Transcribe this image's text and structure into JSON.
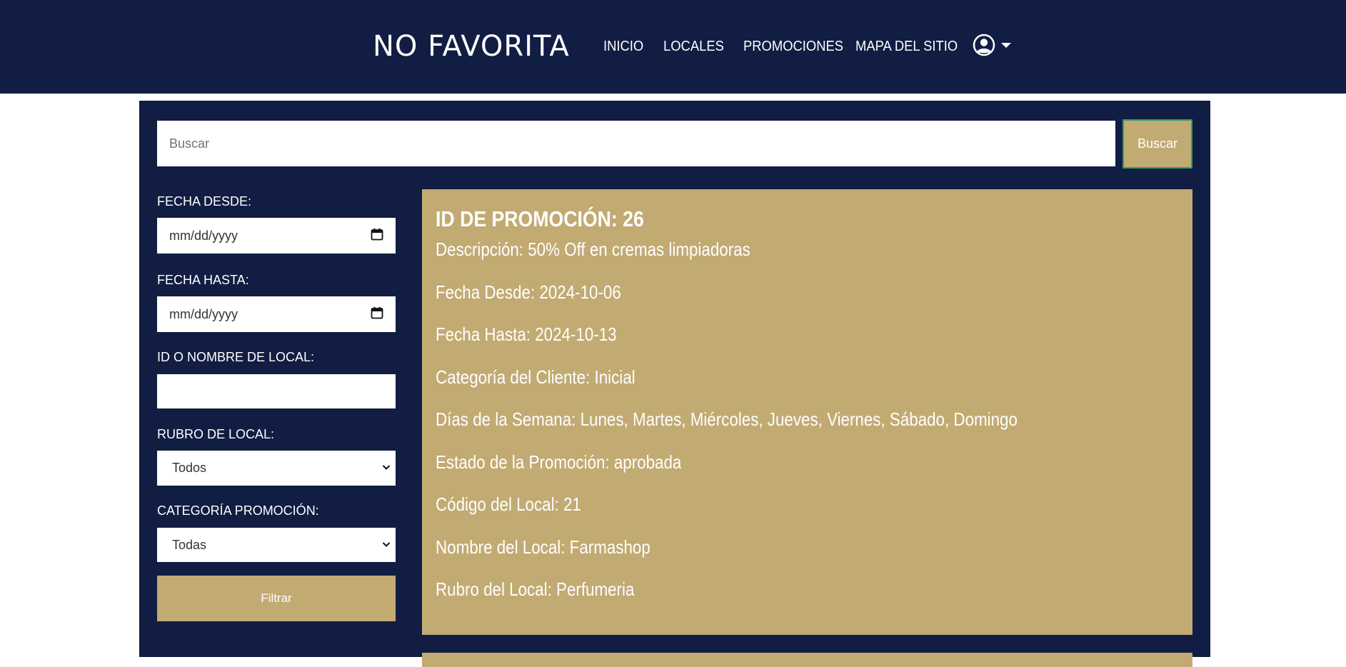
{
  "header": {
    "logo": "NO FAVORITA",
    "nav": [
      {
        "label": "INICIO"
      },
      {
        "label": "LOCALES"
      },
      {
        "label": "PROMOCIONES"
      },
      {
        "label": "MAPA DEL SITIO"
      }
    ],
    "user_icon": "user-circle-icon"
  },
  "search": {
    "placeholder": "Buscar",
    "button_label": "Buscar"
  },
  "filters": {
    "fecha_desde_label": "FECHA DESDE:",
    "fecha_desde_placeholder": "mm/dd/yyyy",
    "fecha_hasta_label": "FECHA HASTA:",
    "fecha_hasta_placeholder": "mm/dd/yyyy",
    "local_label": "ID O NOMBRE DE LOCAL:",
    "local_value": "",
    "rubro_label": "RUBRO DE LOCAL:",
    "rubro_selected": "Todos",
    "categoria_label": "CATEGORÍA PROMOCIÓN:",
    "categoria_selected": "Todas",
    "filter_button_label": "Filtrar"
  },
  "promotion": {
    "title": "ID DE PROMOCIÓN: 26",
    "lines": [
      "Descripción: 50% Off en cremas limpiadoras",
      "Fecha Desde: 2024-10-06",
      "Fecha Hasta: 2024-10-13",
      "Categoría del Cliente: Inicial",
      "Días de la Semana: Lunes, Martes, Miércoles, Jueves, Viernes, Sábado, Domingo",
      "Estado de la Promoción: aprobada",
      "Código del Local: 21",
      "Nombre del Local: Farmashop",
      "Rubro del Local: Perfumeria"
    ]
  },
  "colors": {
    "navy": "#111d42",
    "gold": "#c2aa73",
    "white": "#ffffff"
  }
}
